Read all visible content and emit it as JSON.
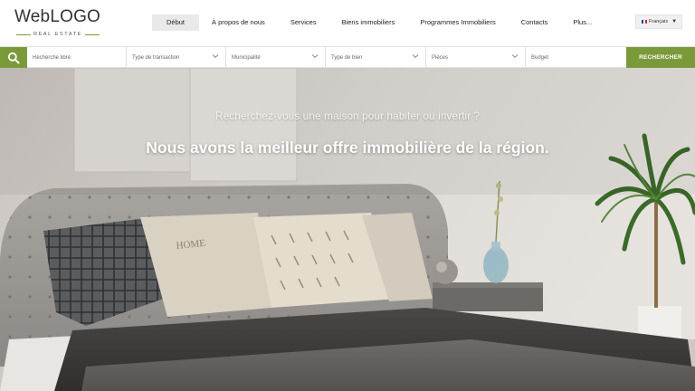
{
  "logo": {
    "text": "WebLOGO",
    "tagline": "REAL ESTATE"
  },
  "nav": {
    "items": [
      {
        "label": "Début",
        "active": true
      },
      {
        "label": "À propos de nous"
      },
      {
        "label": "Services"
      },
      {
        "label": "Biens immobiliers"
      },
      {
        "label": "Programmes Immobiliers"
      },
      {
        "label": "Contacts"
      },
      {
        "label": "Plus..."
      }
    ]
  },
  "language": {
    "label": "Français",
    "icon": "french-flag-icon"
  },
  "search": {
    "free_text_placeholder": "Recherche libre",
    "transaction_type": "Type de transaction",
    "municipality": "Municipalité",
    "property_type": "Type de bien",
    "rooms": "Pièces",
    "budget": "Budget",
    "button_label": "RECHERCHER"
  },
  "hero": {
    "subtitle": "Recherchez-vous une maison pour habiter ou invertir ?",
    "title": "Nous avons la meilleur offre immobilière de la région."
  },
  "colors": {
    "accent": "#7a9a3a"
  }
}
